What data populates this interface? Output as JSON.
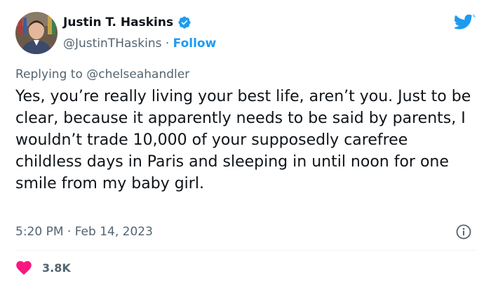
{
  "author": {
    "name": "Justin T. Haskins",
    "handle": "@JustinTHaskins",
    "separator": "·",
    "follow_label": "Follow",
    "verified_icon": "verified-badge-icon",
    "avatar_icon": "avatar-photo"
  },
  "reply": {
    "prefix": "Replying to",
    "mention": "@chelseahandler"
  },
  "tweet": {
    "text": "Yes, you’re really living your best life, aren’t you. Just to be clear, because it apparently needs to be said by parents, I wouldn’t trade 10,000 of your supposedly carefree childless days in Paris and sleeping in until noon for one smile from my baby girl."
  },
  "meta": {
    "timestamp": "5:20 PM · Feb 14, 2023",
    "info_icon": "info-icon"
  },
  "engagement": {
    "likes": "3.8K",
    "like_icon": "heart-icon"
  },
  "colors": {
    "brand_blue": "#1d9bf0",
    "heart_red": "#f91880",
    "secondary_text": "#536471",
    "primary_text": "#0f1419"
  }
}
